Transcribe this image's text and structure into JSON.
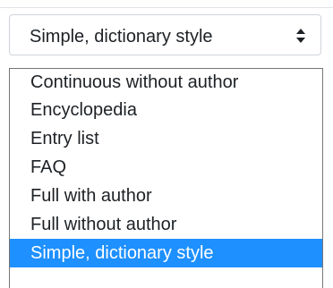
{
  "select": {
    "value": "Simple, dictionary style",
    "arrow_icon": "up-down-chevron-icon"
  },
  "options": [
    {
      "label": "Continuous without author",
      "selected": false
    },
    {
      "label": "Encyclopedia",
      "selected": false
    },
    {
      "label": "Entry list",
      "selected": false
    },
    {
      "label": "FAQ",
      "selected": false
    },
    {
      "label": "Full with author",
      "selected": false
    },
    {
      "label": "Full without author",
      "selected": false
    },
    {
      "label": "Simple, dictionary style",
      "selected": true
    }
  ],
  "colors": {
    "selected_background": "#1e90ff",
    "text": "#1d2125",
    "border": "#cfd4da"
  }
}
